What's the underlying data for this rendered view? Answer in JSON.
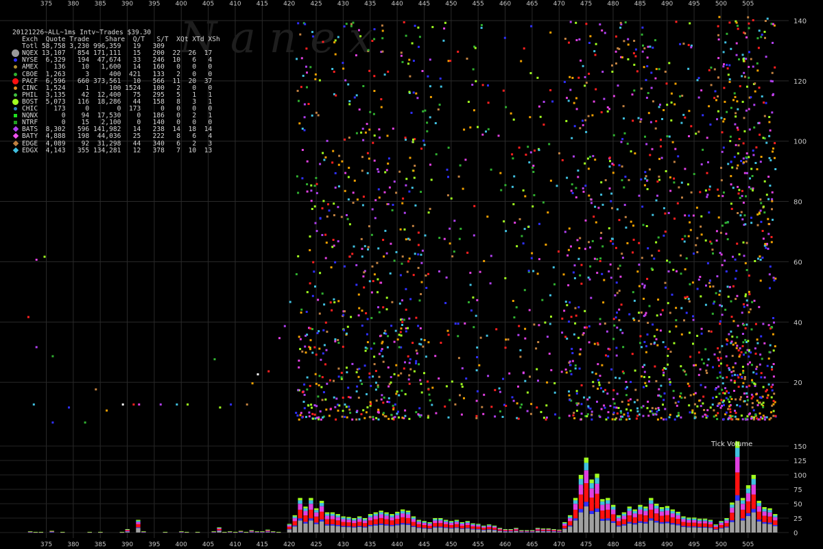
{
  "header_line": "20121226~ALL~1ms Intv~Trades $39.30",
  "legend": {
    "columns": "Exch  Quote Trade    Share  Q/T   S/T  XQt XTd XSh",
    "rows": [
      {
        "marker": "none",
        "color": "#000000",
        "text": "Totl 58,758 3,230 996,359   19   309"
      },
      {
        "marker": "bigdot",
        "color": "#9a9a9a",
        "text": "NQEX 13,107   854 171,111   15   200  22  26  17"
      },
      {
        "marker": "dot",
        "color": "#3030ff",
        "text": "NYSE  6,329   194  47,674   33   246  10   6   4"
      },
      {
        "marker": "dot",
        "color": "#b09030",
        "text": "AMEX    136    10   1,600   14   160   0   0   0"
      },
      {
        "marker": "dot",
        "color": "#30b030",
        "text": "CBOE  1,263     3     400  421   133   2   0   0"
      },
      {
        "marker": "bigcircle",
        "color": "#ff1010",
        "text": "PACF  6,596   660 373,561   10   566  11  20  37"
      },
      {
        "marker": "dot",
        "color": "#e09020",
        "text": "CINC  1,524     1     100 1524   100   2   0   0"
      },
      {
        "marker": "dot",
        "color": "#40c040",
        "text": "PHIL  3,135    42  12,400   75   295   5   1   1"
      },
      {
        "marker": "bigcircle",
        "color": "#a0ff20",
        "text": "BOST  5,073   116  18,286   44   158   8   3   1"
      },
      {
        "marker": "dot",
        "color": "#3080c0",
        "text": "CHIC    173     0       0  173     0   0   0   0"
      },
      {
        "marker": "square",
        "color": "#20e020",
        "text": "NQNX      0    94  17,530    0   186   0   2   1"
      },
      {
        "marker": "square",
        "color": "#20a020",
        "text": "NTRF      0    15   2,100    0   140   0   0   0"
      },
      {
        "marker": "diamond",
        "color": "#b040f0",
        "text": "BATS  8,302   596 141,982   14   238  14  18  14"
      },
      {
        "marker": "diamond",
        "color": "#f050f0",
        "text": "BATY  4,888   198  44,036   25   222   8   6   4"
      },
      {
        "marker": "diamond",
        "color": "#c08040",
        "text": "EDGE  4,089    92  31,298   44   340   6   2   3"
      },
      {
        "marker": "diamond",
        "color": "#40c0e0",
        "text": "EDGX  4,143   355 134,281   12   378   7  10  13"
      }
    ]
  },
  "watermark": "N   a   n   e   x",
  "volume_label": "Tick Volume",
  "chart_data": [
    {
      "type": "scatter",
      "title": "",
      "xlim": [
        371,
        511
      ],
      "ylim": [
        0,
        145
      ],
      "x_ticks": [
        375,
        380,
        385,
        390,
        395,
        400,
        405,
        410,
        415,
        420,
        425,
        430,
        435,
        440,
        445,
        450,
        455,
        460,
        465,
        470,
        475,
        480,
        485,
        490,
        495,
        500,
        505
      ],
      "y_ticks": [
        20,
        40,
        60,
        80,
        100,
        120,
        140
      ],
      "colors": [
        "#ff2020",
        "#e040e0",
        "#b040f0",
        "#40c0e0",
        "#a0ff20",
        "#30b030",
        "#3030ff",
        "#c08040",
        "#f0a000",
        "#ffffff"
      ],
      "dense_regions": [
        {
          "x": [
            421,
            446
          ],
          "y": [
            8,
            140
          ],
          "points": 650
        },
        {
          "x": [
            446,
            471
          ],
          "y": [
            8,
            140
          ],
          "points": 260
        },
        {
          "x": [
            471,
            499
          ],
          "y": [
            8,
            140
          ],
          "points": 760
        },
        {
          "x": [
            499,
            510
          ],
          "y": [
            8,
            142
          ],
          "points": 560
        }
      ],
      "sparse_points": [
        [
          371.5,
          42
        ],
        [
          373,
          61
        ],
        [
          373,
          32
        ],
        [
          372.5,
          13
        ],
        [
          374.5,
          62
        ],
        [
          376,
          29
        ],
        [
          379,
          12
        ],
        [
          384,
          18
        ],
        [
          386,
          11
        ],
        [
          389,
          13
        ],
        [
          391,
          13
        ],
        [
          392,
          13
        ],
        [
          396,
          13
        ],
        [
          399,
          13
        ],
        [
          401,
          13
        ],
        [
          406,
          28
        ],
        [
          409,
          13
        ],
        [
          412,
          13
        ],
        [
          413,
          20
        ],
        [
          414,
          23
        ],
        [
          416,
          24
        ],
        [
          418,
          35
        ],
        [
          419,
          39
        ],
        [
          420,
          47
        ],
        [
          407,
          12
        ],
        [
          382,
          7
        ],
        [
          376,
          7
        ]
      ]
    },
    {
      "type": "bar",
      "title": "Tick Volume",
      "ylim": [
        0,
        150
      ],
      "y_ticks": [
        0,
        25,
        50,
        75,
        100,
        125,
        150
      ],
      "x": [
        372,
        373,
        374,
        376,
        378,
        383,
        385,
        389,
        390,
        392,
        393,
        397,
        400,
        401,
        403,
        406,
        407,
        408,
        409,
        410,
        411,
        412,
        413,
        414,
        415,
        416,
        417,
        418,
        420,
        421,
        422,
        423,
        424,
        425,
        426,
        427,
        428,
        429,
        430,
        431,
        432,
        433,
        434,
        435,
        436,
        437,
        438,
        439,
        440,
        441,
        442,
        443,
        444,
        445,
        446,
        447,
        448,
        449,
        450,
        451,
        452,
        453,
        454,
        455,
        456,
        457,
        458,
        459,
        460,
        461,
        462,
        463,
        464,
        465,
        466,
        467,
        468,
        469,
        470,
        471,
        472,
        473,
        474,
        475,
        476,
        477,
        478,
        479,
        480,
        481,
        482,
        483,
        484,
        485,
        486,
        487,
        488,
        489,
        490,
        491,
        492,
        493,
        494,
        495,
        496,
        497,
        498,
        499,
        500,
        501,
        502,
        503,
        504,
        505,
        506,
        507,
        508,
        509,
        510
      ],
      "values": [
        2,
        1,
        1,
        3,
        1,
        1,
        1,
        1,
        6,
        22,
        2,
        1,
        2,
        1,
        1,
        2,
        9,
        1,
        2,
        1,
        3,
        1,
        4,
        2,
        2,
        5,
        2,
        1,
        15,
        30,
        60,
        45,
        60,
        42,
        55,
        35,
        35,
        32,
        28,
        27,
        25,
        28,
        25,
        32,
        35,
        38,
        35,
        32,
        36,
        40,
        38,
        28,
        22,
        20,
        18,
        25,
        25,
        22,
        20,
        22,
        18,
        20,
        16,
        15,
        12,
        14,
        12,
        8,
        6,
        6,
        8,
        4,
        4,
        4,
        8,
        7,
        7,
        6,
        5,
        18,
        30,
        60,
        100,
        130,
        92,
        102,
        58,
        60,
        48,
        30,
        35,
        45,
        40,
        48,
        45,
        60,
        50,
        44,
        46,
        40,
        36,
        28,
        26,
        26,
        24,
        24,
        22,
        14,
        20,
        25,
        52,
        158,
        60,
        82,
        100,
        55,
        44,
        42,
        32,
        36,
        28,
        36,
        32,
        25
      ]
    }
  ]
}
